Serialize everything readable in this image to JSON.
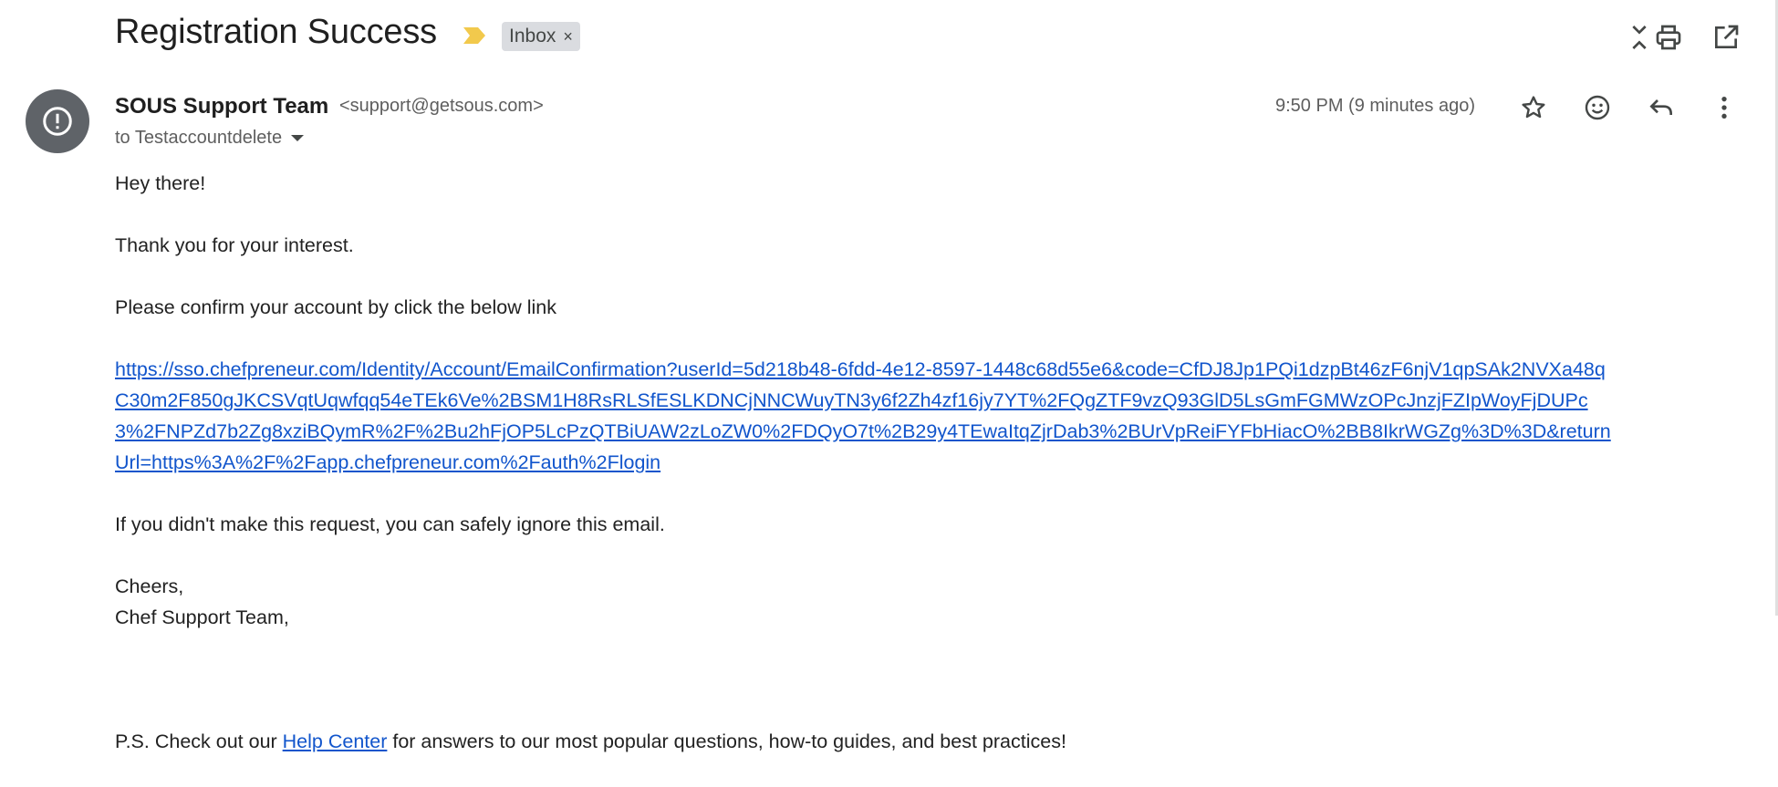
{
  "header": {
    "subject": "Registration Success",
    "label": "Inbox",
    "label_remove": "×",
    "icons": [
      "collapse-all-icon",
      "print-icon",
      "open-in-new-window-icon"
    ]
  },
  "message": {
    "sender_name": "SOUS Support Team",
    "sender_email": "<support@getsous.com>",
    "recipient": "to Testaccountdelete",
    "timestamp": "9:50 PM (9 minutes ago)",
    "actions": [
      "star-icon",
      "emoji-reaction-icon",
      "reply-icon",
      "more-options-icon"
    ],
    "avatar_icon": "warning-icon"
  },
  "body": {
    "greeting": "Hey there!",
    "thanks": "Thank you for your interest.",
    "instruction": "Please confirm your account by click the below link",
    "confirm_link": "https://sso.chefpreneur.com/Identity/Account/EmailConfirmation?userId=5d218b48-6fdd-4e12-8597-1448c68d55e6&code=CfDJ8Jp1PQi1dzpBt46zF6njV1qpSAk2NVXa48qC30m2F850gJKCSVqtUqwfqq54eTEk6Ve%2BSM1H8RsRLSfESLKDNCjNNCWuyTN3y6f2Zh4zf16jy7YT%2FQgZTF9vzQ93GlD5LsGmFGMWzOPcJnzjFZIpWoyFjDUPc3%2FNPZd7b2Zg8xziBQymR%2F%2Bu2hFjOP5LcPzQTBiUAW2zLoZW0%2FDQyO7t%2B29y4TEwaItqZjrDab3%2BUrVpReiFYFbHiacO%2BB8IkrWGZg%3D%3D&returnUrl=https%3A%2F%2Fapp.chefpreneur.com%2Fauth%2Flogin",
    "ignore_note": "If you didn't make this request, you can safely ignore this email.",
    "signoff": "Cheers,",
    "signature": "Chef Support Team,",
    "ps_prefix": "P.S. Check out our ",
    "ps_link": "Help Center",
    "ps_suffix": " for answers to our most popular questions, how-to guides, and best practices!"
  },
  "colors": {
    "link": "#1155cc",
    "importance_marker": "#f2c94c",
    "avatar_bg": "#5f6368",
    "label_chip_bg": "#dadce0"
  }
}
